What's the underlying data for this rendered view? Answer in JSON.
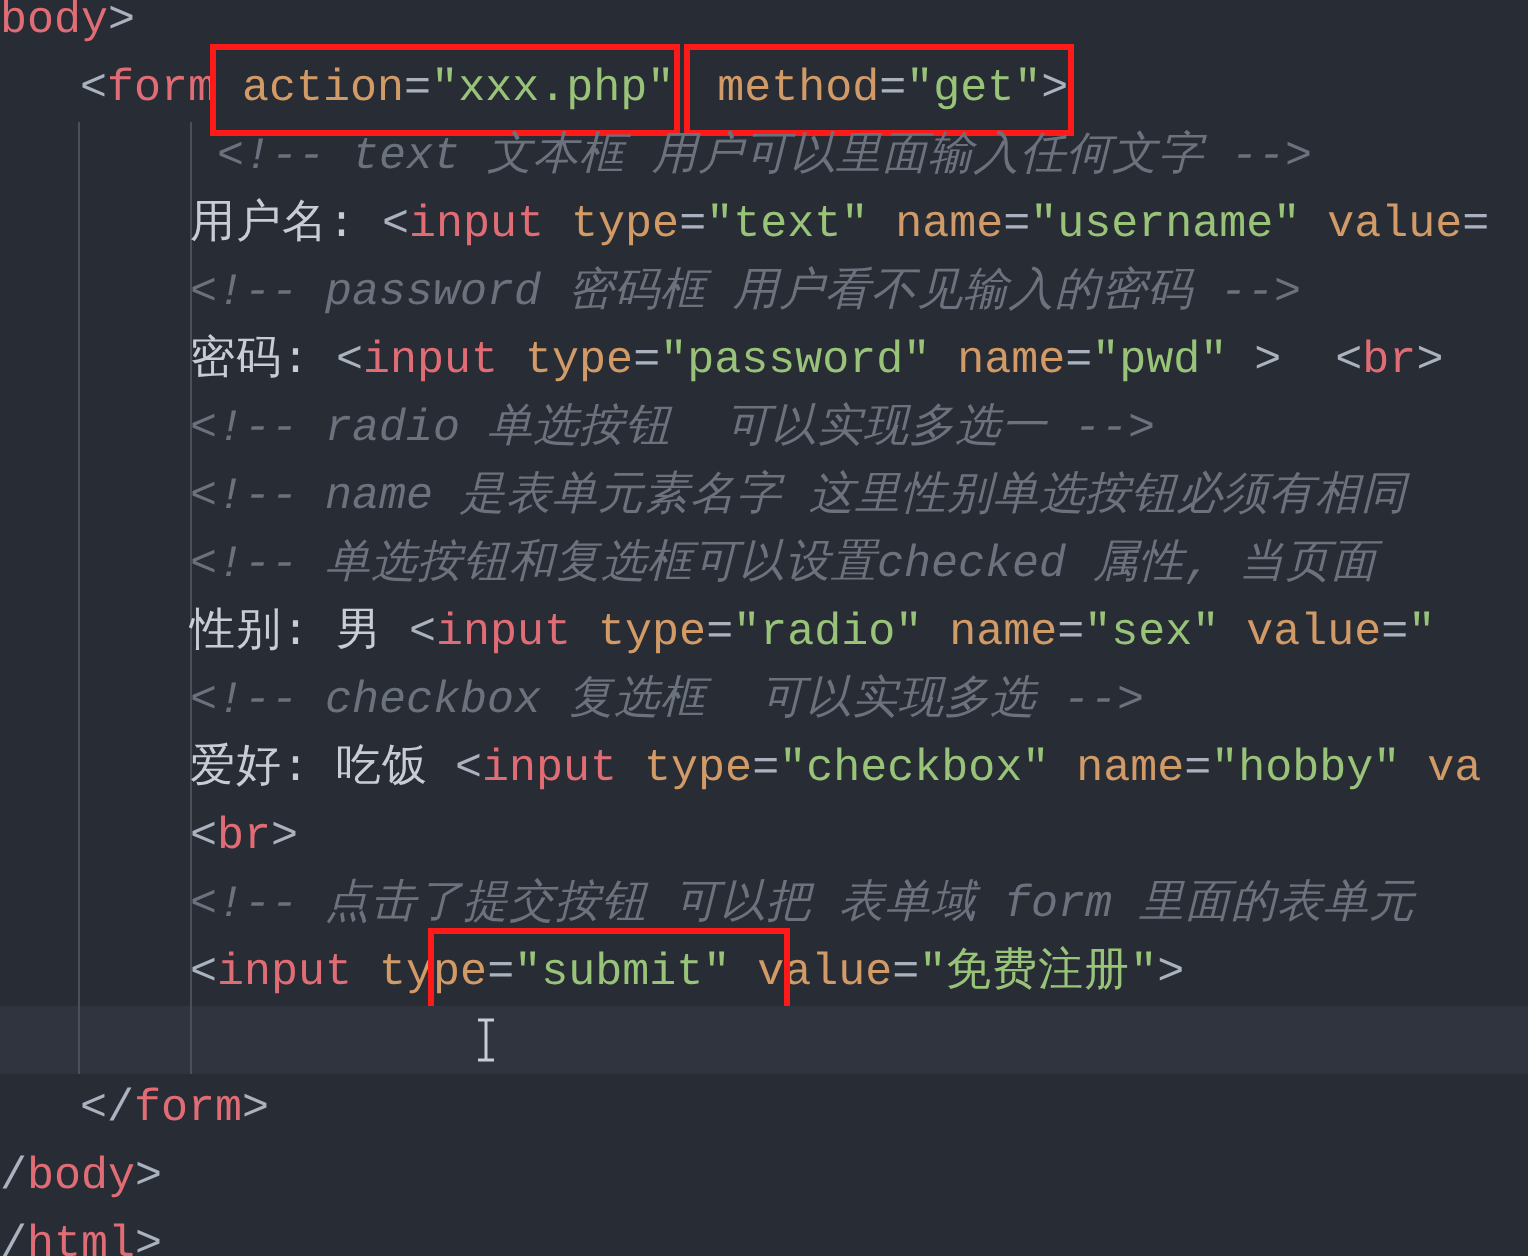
{
  "editor": {
    "lines": [
      {
        "current": false,
        "segments": [
          {
            "kind": "tag",
            "text": "body"
          },
          {
            "kind": "punct",
            "text": ">"
          }
        ],
        "children": [
          {
            "current": false,
            "segments": [
              {
                "kind": "punct",
                "text": "<"
              },
              {
                "kind": "tag",
                "text": "form"
              },
              {
                "kind": "box",
                "segments": [
                  {
                    "kind": "attr",
                    "text": " action"
                  },
                  {
                    "kind": "punct",
                    "text": "="
                  },
                  {
                    "kind": "string",
                    "text": "\"xxx.php\""
                  }
                ]
              },
              {
                "kind": "box",
                "segments": [
                  {
                    "kind": "attr",
                    "text": " method"
                  },
                  {
                    "kind": "punct",
                    "text": "="
                  },
                  {
                    "kind": "string",
                    "text": "\"get\""
                  },
                  {
                    "kind": "punct",
                    "text": ">"
                  }
                ]
              }
            ],
            "children": [
              {
                "current": false,
                "segments": [
                  {
                    "kind": "comment",
                    "text": " <!-- text 文本框 用户可以里面输入任何文字 -->"
                  }
                ]
              },
              {
                "current": false,
                "segments": [
                  {
                    "kind": "plain",
                    "text": "用户名: "
                  },
                  {
                    "kind": "punct",
                    "text": "<"
                  },
                  {
                    "kind": "tag",
                    "text": "input"
                  },
                  {
                    "kind": "attr",
                    "text": " type"
                  },
                  {
                    "kind": "punct",
                    "text": "="
                  },
                  {
                    "kind": "string",
                    "text": "\"text\""
                  },
                  {
                    "kind": "attr",
                    "text": " name"
                  },
                  {
                    "kind": "punct",
                    "text": "="
                  },
                  {
                    "kind": "string",
                    "text": "\"username\""
                  },
                  {
                    "kind": "attr",
                    "text": " value"
                  },
                  {
                    "kind": "punct",
                    "text": "="
                  }
                ]
              },
              {
                "current": false,
                "segments": [
                  {
                    "kind": "comment",
                    "text": "<!-- password 密码框 用户看不见输入的密码 -->"
                  }
                ]
              },
              {
                "current": false,
                "segments": [
                  {
                    "kind": "plain",
                    "text": "密码: "
                  },
                  {
                    "kind": "punct",
                    "text": "<"
                  },
                  {
                    "kind": "tag",
                    "text": "input"
                  },
                  {
                    "kind": "attr",
                    "text": " type"
                  },
                  {
                    "kind": "punct",
                    "text": "="
                  },
                  {
                    "kind": "string",
                    "text": "\"password\""
                  },
                  {
                    "kind": "attr",
                    "text": " name"
                  },
                  {
                    "kind": "punct",
                    "text": "="
                  },
                  {
                    "kind": "string",
                    "text": "\"pwd\""
                  },
                  {
                    "kind": "punct",
                    "text": " >  <"
                  },
                  {
                    "kind": "tag",
                    "text": "br"
                  },
                  {
                    "kind": "punct",
                    "text": ">"
                  }
                ]
              },
              {
                "current": false,
                "segments": [
                  {
                    "kind": "comment",
                    "text": "<!-- radio 单选按钮  可以实现多选一 -->"
                  }
                ]
              },
              {
                "current": false,
                "segments": [
                  {
                    "kind": "comment",
                    "text": "<!-- name 是表单元素名字 这里性别单选按钮必须有相同"
                  }
                ]
              },
              {
                "current": false,
                "segments": [
                  {
                    "kind": "comment",
                    "text": "<!-- 单选按钮和复选框可以设置checked 属性, 当页面"
                  }
                ]
              },
              {
                "current": false,
                "segments": [
                  {
                    "kind": "plain",
                    "text": "性别: 男 "
                  },
                  {
                    "kind": "punct",
                    "text": "<"
                  },
                  {
                    "kind": "tag",
                    "text": "input"
                  },
                  {
                    "kind": "attr",
                    "text": " type"
                  },
                  {
                    "kind": "punct",
                    "text": "="
                  },
                  {
                    "kind": "string",
                    "text": "\"radio\""
                  },
                  {
                    "kind": "attr",
                    "text": " name"
                  },
                  {
                    "kind": "punct",
                    "text": "="
                  },
                  {
                    "kind": "string",
                    "text": "\"sex\""
                  },
                  {
                    "kind": "attr",
                    "text": " value"
                  },
                  {
                    "kind": "punct",
                    "text": "="
                  },
                  {
                    "kind": "string",
                    "text": "\""
                  }
                ]
              },
              {
                "current": false,
                "segments": [
                  {
                    "kind": "comment",
                    "text": "<!-- checkbox 复选框  可以实现多选 -->"
                  }
                ]
              },
              {
                "current": false,
                "segments": [
                  {
                    "kind": "plain",
                    "text": "爱好: 吃饭 "
                  },
                  {
                    "kind": "punct",
                    "text": "<"
                  },
                  {
                    "kind": "tag",
                    "text": "input"
                  },
                  {
                    "kind": "attr",
                    "text": " type"
                  },
                  {
                    "kind": "punct",
                    "text": "="
                  },
                  {
                    "kind": "string",
                    "text": "\"checkbox\""
                  },
                  {
                    "kind": "attr",
                    "text": " name"
                  },
                  {
                    "kind": "punct",
                    "text": "="
                  },
                  {
                    "kind": "string",
                    "text": "\"hobby\""
                  },
                  {
                    "kind": "attr",
                    "text": " va"
                  }
                ]
              },
              {
                "current": false,
                "segments": [
                  {
                    "kind": "punct",
                    "text": "<"
                  },
                  {
                    "kind": "tag",
                    "text": "br"
                  },
                  {
                    "kind": "punct",
                    "text": ">"
                  }
                ]
              },
              {
                "current": false,
                "segments": [
                  {
                    "kind": "comment",
                    "text": "<!-- 点击了提交按钮 可以把 表单域 form 里面的表单元"
                  }
                ]
              },
              {
                "current": false,
                "segments": [
                  {
                    "kind": "punct",
                    "text": "<"
                  },
                  {
                    "kind": "tag",
                    "text": "input"
                  },
                  {
                    "kind": "attr",
                    "text": " ty"
                  },
                  {
                    "kind": "box_tall",
                    "segments": [
                      {
                        "kind": "attr",
                        "text": "pe"
                      },
                      {
                        "kind": "punct",
                        "text": "="
                      },
                      {
                        "kind": "string",
                        "text": "\"submit\""
                      },
                      {
                        "kind": "attr",
                        "text": " v"
                      }
                    ]
                  },
                  {
                    "kind": "attr",
                    "text": "alue"
                  },
                  {
                    "kind": "punct",
                    "text": "="
                  },
                  {
                    "kind": "string",
                    "text": "\"免费注册\""
                  },
                  {
                    "kind": "punct",
                    "text": ">"
                  }
                ]
              },
              {
                "current": true
              }
            ]
          },
          {
            "current": false,
            "segments": [
              {
                "kind": "punct",
                "text": "</"
              },
              {
                "kind": "tag",
                "text": "form"
              },
              {
                "kind": "punct",
                "text": ">"
              }
            ]
          }
        ]
      },
      {
        "current": false,
        "segments": [
          {
            "kind": "punct",
            "text": "/"
          },
          {
            "kind": "tag",
            "text": "body"
          },
          {
            "kind": "punct",
            "text": ">"
          }
        ]
      },
      {
        "current": false,
        "segments": [
          {
            "kind": "punct",
            "text": "/"
          },
          {
            "kind": "tag",
            "text": "html"
          },
          {
            "kind": "punct",
            "text": ">"
          }
        ]
      }
    ]
  }
}
